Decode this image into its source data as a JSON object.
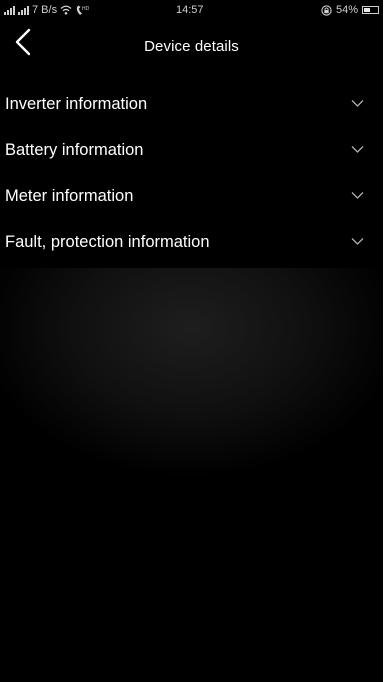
{
  "status_bar": {
    "signal_1": "⁴⁶",
    "signal_2": "⁴⁶",
    "net_speed": "7 B/s",
    "hd_label": "HD",
    "time": "14:57",
    "battery_percent": "54%",
    "battery_level": 0.54
  },
  "header": {
    "title": "Device details",
    "back_icon": "chevron-left-icon"
  },
  "sections": [
    {
      "label": "Inverter information",
      "icon": "chevron-down-icon",
      "expanded": false
    },
    {
      "label": "Battery information",
      "icon": "chevron-down-icon",
      "expanded": false
    },
    {
      "label": "Meter information",
      "icon": "chevron-down-icon",
      "expanded": false
    },
    {
      "label": "Fault, protection information",
      "icon": "chevron-down-icon",
      "expanded": false
    }
  ],
  "colors": {
    "background": "#000000",
    "text": "#ffffff",
    "chevron": "#b0b0b0"
  }
}
